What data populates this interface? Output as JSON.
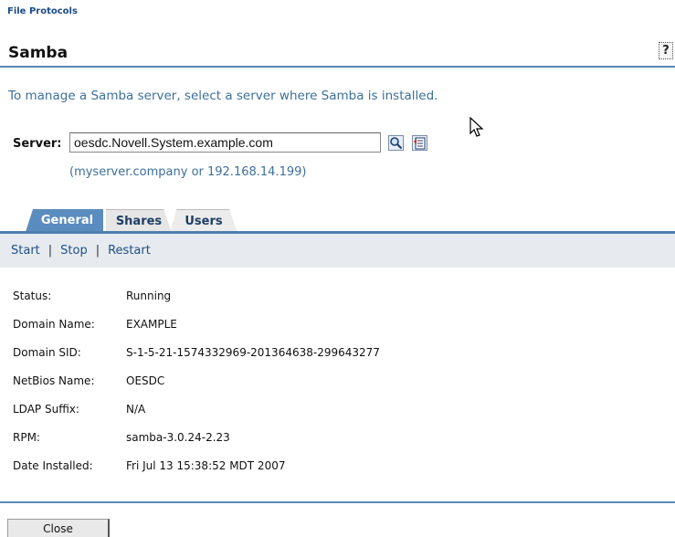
{
  "breadcrumb": "File Protocols",
  "title": "Samba",
  "help_label": "?",
  "instructions": "To manage a Samba server, select a server where Samba is installed.",
  "server": {
    "label": "Server:",
    "value": "oesdc.Novell.System.example.com",
    "hint": "(myserver.company or 192.168.14.199)",
    "icons": [
      "search-icon",
      "object-browser-icon"
    ]
  },
  "tabs": [
    {
      "label": "General",
      "active": true
    },
    {
      "label": "Shares",
      "active": false
    },
    {
      "label": "Users",
      "active": false
    }
  ],
  "actions": [
    {
      "label": "Start"
    },
    {
      "label": "Stop"
    },
    {
      "label": "Restart"
    }
  ],
  "action_separator": "|",
  "details": [
    {
      "label": "Status:",
      "value": "Running"
    },
    {
      "label": "Domain Name:",
      "value": "EXAMPLE"
    },
    {
      "label": "Domain SID:",
      "value": "S-1-5-21-1574332969-201364638-299643277"
    },
    {
      "label": "NetBios Name:",
      "value": "OESDC"
    },
    {
      "label": "LDAP Suffix:",
      "value": "N/A"
    },
    {
      "label": "RPM:",
      "value": "samba-3.0.24-2.23"
    },
    {
      "label": "Date Installed:",
      "value": "Fri Jul 13 15:38:52 MDT 2007"
    }
  ],
  "close_label": "Close",
  "colors": {
    "accent": "#4f7fae",
    "link": "#3d6f9c",
    "tab_active": "#5b8cc0",
    "action_bar": "#e7ebef"
  }
}
